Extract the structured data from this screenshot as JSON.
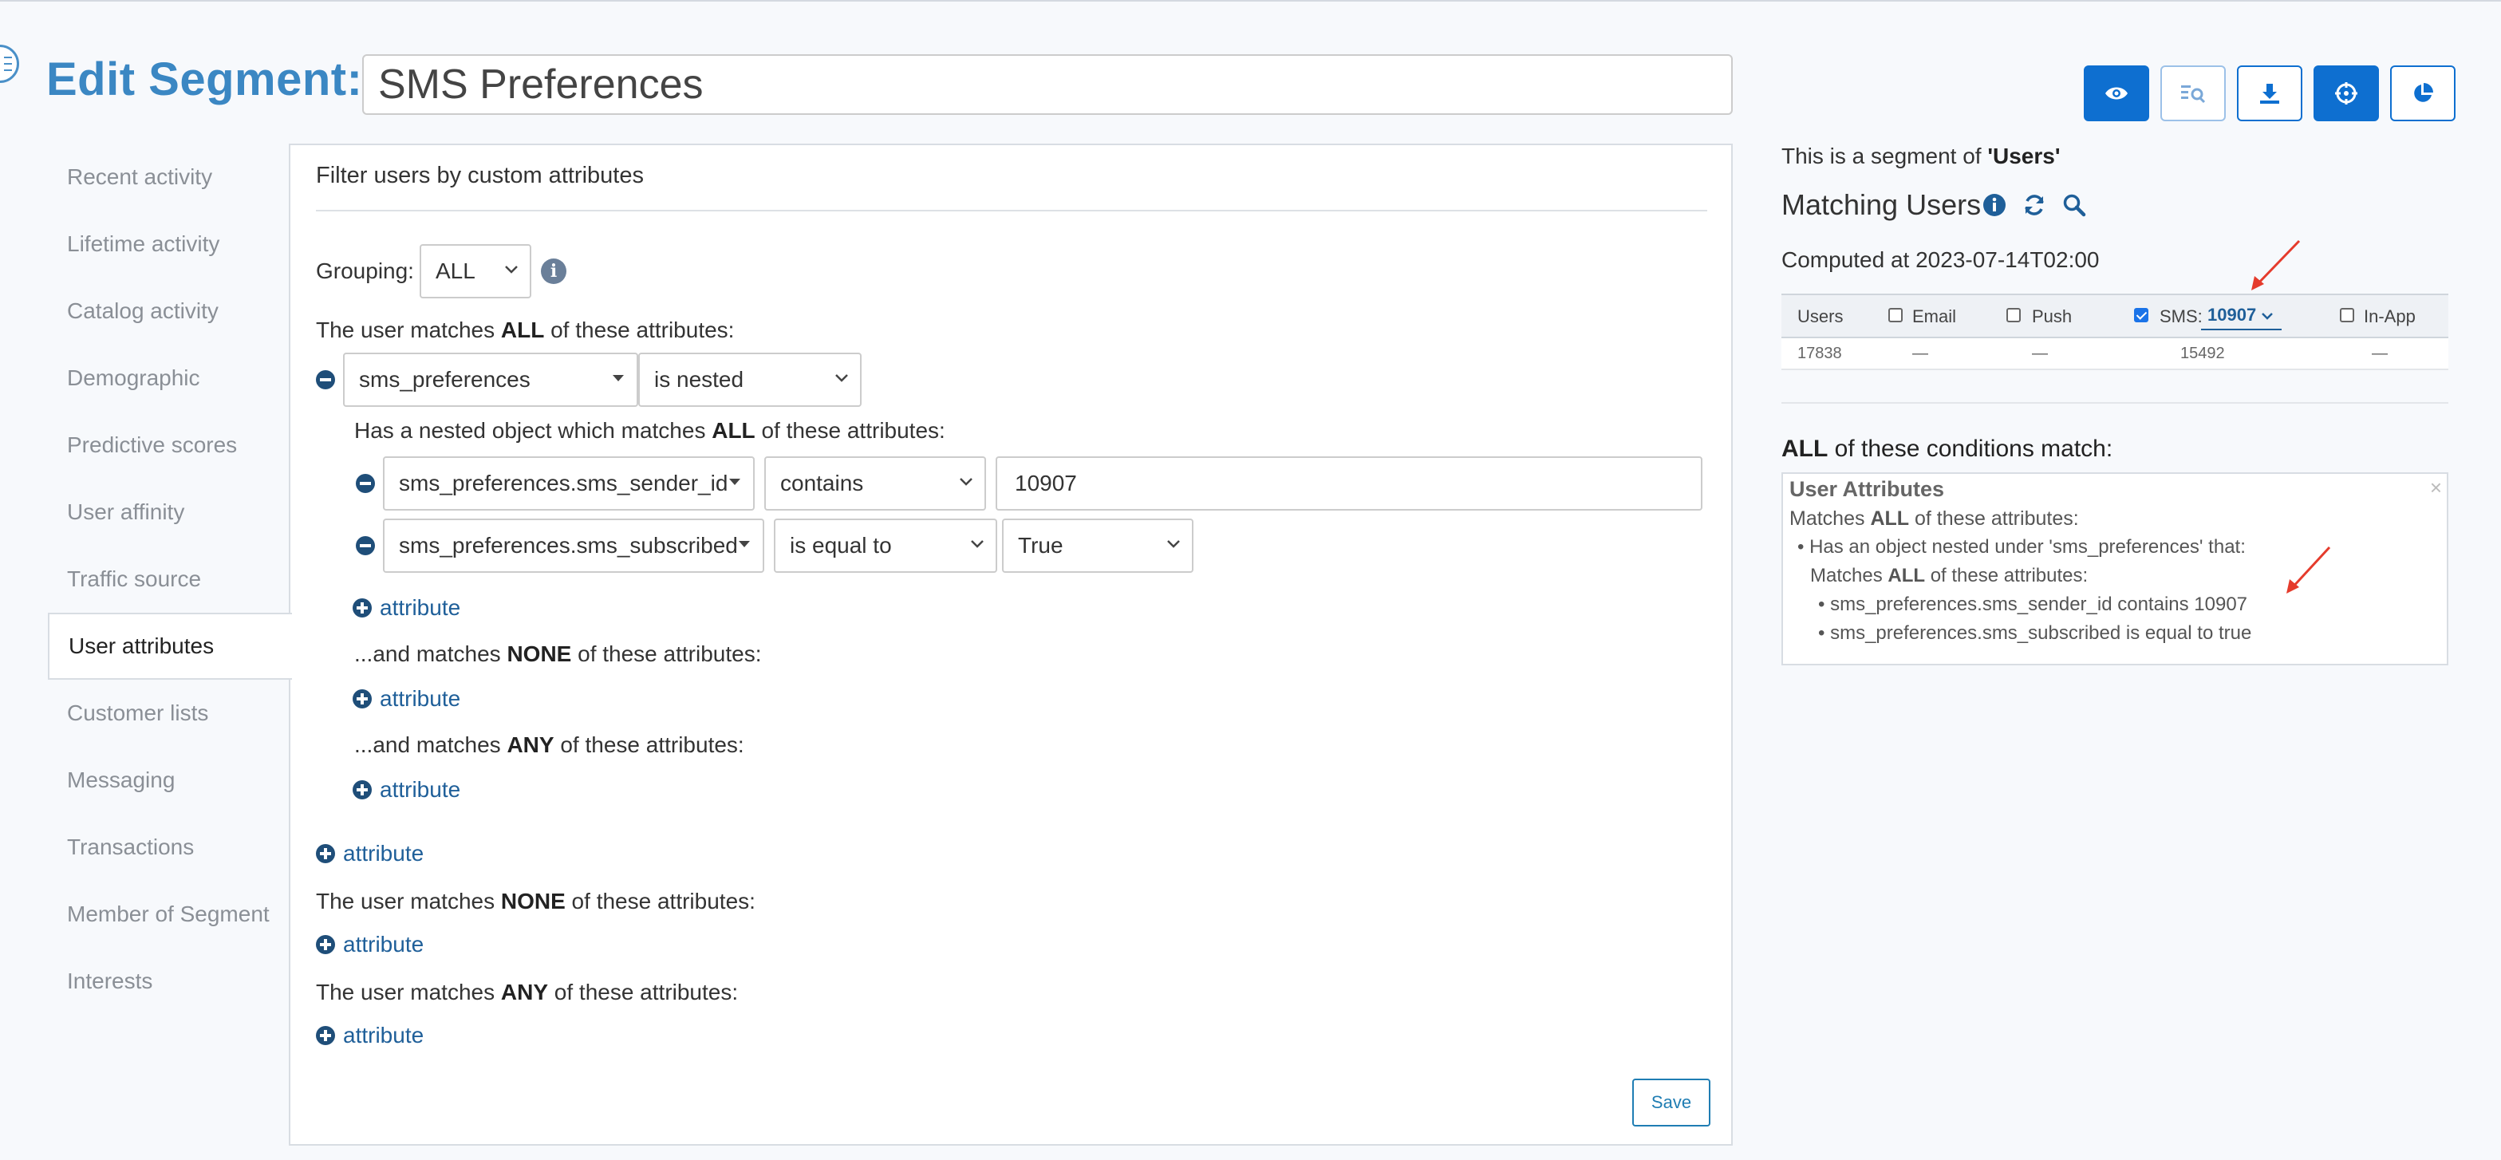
{
  "header": {
    "title": "Edit Segment:",
    "segment_name": "SMS Preferences"
  },
  "toolbar": {
    "buttons": [
      {
        "icon": "eye-icon",
        "style": "filled"
      },
      {
        "icon": "search-list-icon",
        "style": "outline-light"
      },
      {
        "icon": "download-icon",
        "style": "outline"
      },
      {
        "icon": "crosshair-icon",
        "style": "filled"
      },
      {
        "icon": "pie-chart-icon",
        "style": "outline"
      }
    ]
  },
  "sidebar": {
    "items": [
      {
        "label": "Recent activity"
      },
      {
        "label": "Lifetime activity"
      },
      {
        "label": "Catalog activity"
      },
      {
        "label": "Demographic"
      },
      {
        "label": "Predictive scores"
      },
      {
        "label": "User affinity"
      },
      {
        "label": "Traffic source"
      },
      {
        "label": "User attributes",
        "active": true
      },
      {
        "label": "Customer lists"
      },
      {
        "label": "Messaging"
      },
      {
        "label": "Transactions"
      },
      {
        "label": "Member of Segment"
      },
      {
        "label": "Interests"
      }
    ]
  },
  "filter": {
    "title": "Filter users by custom attributes",
    "grouping_label": "Grouping:",
    "grouping_value": "ALL",
    "all_prefix": "The user matches ",
    "all_bold": "ALL",
    "all_suffix": " of these attributes:",
    "attr_name": "sms_preferences",
    "attr_operator": "is nested",
    "nested_prefix": "Has a nested object which matches ",
    "nested_bold": "ALL",
    "nested_suffix": " of these attributes:",
    "nested_rows": [
      {
        "field": "sms_preferences.sms_sender_id",
        "operator": "contains",
        "value": "10907"
      },
      {
        "field": "sms_preferences.sms_subscribed",
        "operator": "is equal to",
        "value": "True"
      }
    ],
    "add_attribute": "attribute",
    "nested_none_prefix": "...and matches ",
    "nested_none_bold": "NONE",
    "nested_none_suffix": " of these attributes:",
    "nested_any_prefix": "...and matches ",
    "nested_any_bold": "ANY",
    "nested_any_suffix": " of these attributes:",
    "none_prefix": "The user matches ",
    "none_bold": "NONE",
    "none_suffix": " of these attributes:",
    "any_prefix": "The user matches ",
    "any_bold": "ANY",
    "any_suffix": " of these attributes:",
    "save_label": "Save"
  },
  "summary": {
    "segment_of_prefix": "This is a segment of ",
    "segment_of_value": "'Users'",
    "matching_title": "Matching Users",
    "computed": "Computed at 2023-07-14T02:00",
    "columns": {
      "users": "Users",
      "email": "Email",
      "push": "Push",
      "sms": "SMS:",
      "sms_sender": "10907",
      "inapp": "In-App"
    },
    "checks": {
      "email": false,
      "push": false,
      "sms": true,
      "inapp": false
    },
    "values": {
      "users": "17838",
      "email": "—",
      "push": "—",
      "sms": "15492",
      "inapp": "—"
    },
    "conditions_bold": "ALL",
    "conditions_suffix": " of these conditions match:",
    "cond_heading": "User Attributes",
    "cond_line1_prefix": "Matches ",
    "cond_line1_bold": "ALL",
    "cond_line1_suffix": " of these attributes:",
    "cond_line2": "• Has an object nested under 'sms_preferences' that:",
    "cond_line3_prefix": "Matches ",
    "cond_line3_bold": "ALL",
    "cond_line3_suffix": " of these attributes:",
    "cond_line4": "• sms_preferences.sms_sender_id contains 10907",
    "cond_line5": "• sms_preferences.sms_subscribed is equal to true",
    "close_glyph": "×"
  },
  "colors": {
    "title_blue": "#3b87c3",
    "primary_button": "#0e6fd0",
    "link_blue": "#1f5f99",
    "annotation_arrow": "#e53b2c"
  }
}
